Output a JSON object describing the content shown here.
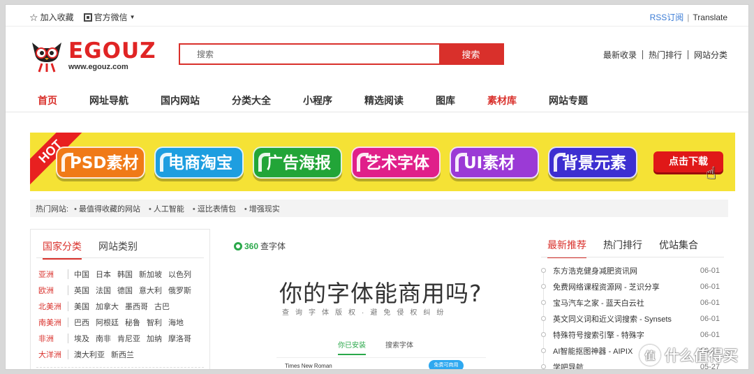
{
  "topbar": {
    "bookmark": "加入收藏",
    "wechat": "官方微信",
    "rss": "RSS订阅",
    "sep": "|",
    "translate": "Translate"
  },
  "header": {
    "logo_text": "EGOUZ",
    "logo_url": "www.egouz.com",
    "search_placeholder": "搜索",
    "search_button": "搜索",
    "links": [
      "最新收录",
      "热门排行",
      "网站分类"
    ]
  },
  "nav": {
    "items": [
      "首页",
      "网址导航",
      "国内网站",
      "分类大全",
      "小程序",
      "精选阅读",
      "图库",
      "素材库",
      "网站专题"
    ]
  },
  "banner": {
    "hot": "HOT",
    "pills": [
      {
        "label": "PSD素材",
        "color": "#f07a17"
      },
      {
        "label": "电商淘宝",
        "color": "#1e9ee0"
      },
      {
        "label": "广告海报",
        "color": "#22a538"
      },
      {
        "label": "艺术字体",
        "color": "#e01f8a"
      },
      {
        "label": "UI素材",
        "color": "#9b3ad6"
      },
      {
        "label": "背景元素",
        "color": "#3d2fd1"
      }
    ],
    "cta": "点击下载"
  },
  "hot_sites": {
    "label": "热门网站:",
    "items": [
      "最值得收藏的网站",
      "人工智能",
      "逗比表情包",
      "增强现实"
    ]
  },
  "left_panel": {
    "tabs": [
      "国家分类",
      "网站类别"
    ],
    "regions": [
      {
        "name": "亚洲",
        "countries": [
          "中国",
          "日本",
          "韩国",
          "新加坡",
          "以色列"
        ]
      },
      {
        "name": "欧洲",
        "countries": [
          "英国",
          "法国",
          "德国",
          "意大利",
          "俄罗斯"
        ]
      },
      {
        "name": "北美洲",
        "countries": [
          "美国",
          "加拿大",
          "墨西哥",
          "古巴"
        ]
      },
      {
        "name": "南美洲",
        "countries": [
          "巴西",
          "阿根廷",
          "秘鲁",
          "智利",
          "海地"
        ]
      },
      {
        "name": "非洲",
        "countries": [
          "埃及",
          "南非",
          "肯尼亚",
          "加纳",
          "摩洛哥"
        ]
      },
      {
        "name": "大洋洲",
        "countries": [
          "澳大利亚",
          "新西兰"
        ]
      }
    ]
  },
  "center": {
    "brand_a": "360",
    "brand_b": "查字体",
    "headline": "你的字体能商用吗?",
    "subline": "查询字体版权·避免侵权纠纷",
    "tabs": [
      "你已安装",
      "搜索字体"
    ],
    "font_name": "Times New Roman",
    "font_button": "免费可商用"
  },
  "right_panel": {
    "tabs": [
      "最新推荐",
      "热门排行",
      "优站集合"
    ],
    "items": [
      {
        "title": "东方浩克健身减肥资讯网",
        "date": "06-01"
      },
      {
        "title": "免费网络课程资源网 - 芝识分享",
        "date": "06-01"
      },
      {
        "title": "宝马汽车之家 - 蓝天白云社",
        "date": "06-01"
      },
      {
        "title": "英文同义词和近义词搜索 - Synsets",
        "date": "06-01"
      },
      {
        "title": "特殊符号搜索引擎 - 特殊字",
        "date": "06-01"
      },
      {
        "title": "AI智能抠图神器 - AIPIX",
        "date": "06-01"
      },
      {
        "title": "学吧导航",
        "date": "05-27"
      }
    ]
  },
  "watermark": {
    "logo": "值",
    "text": "什么值得买"
  }
}
